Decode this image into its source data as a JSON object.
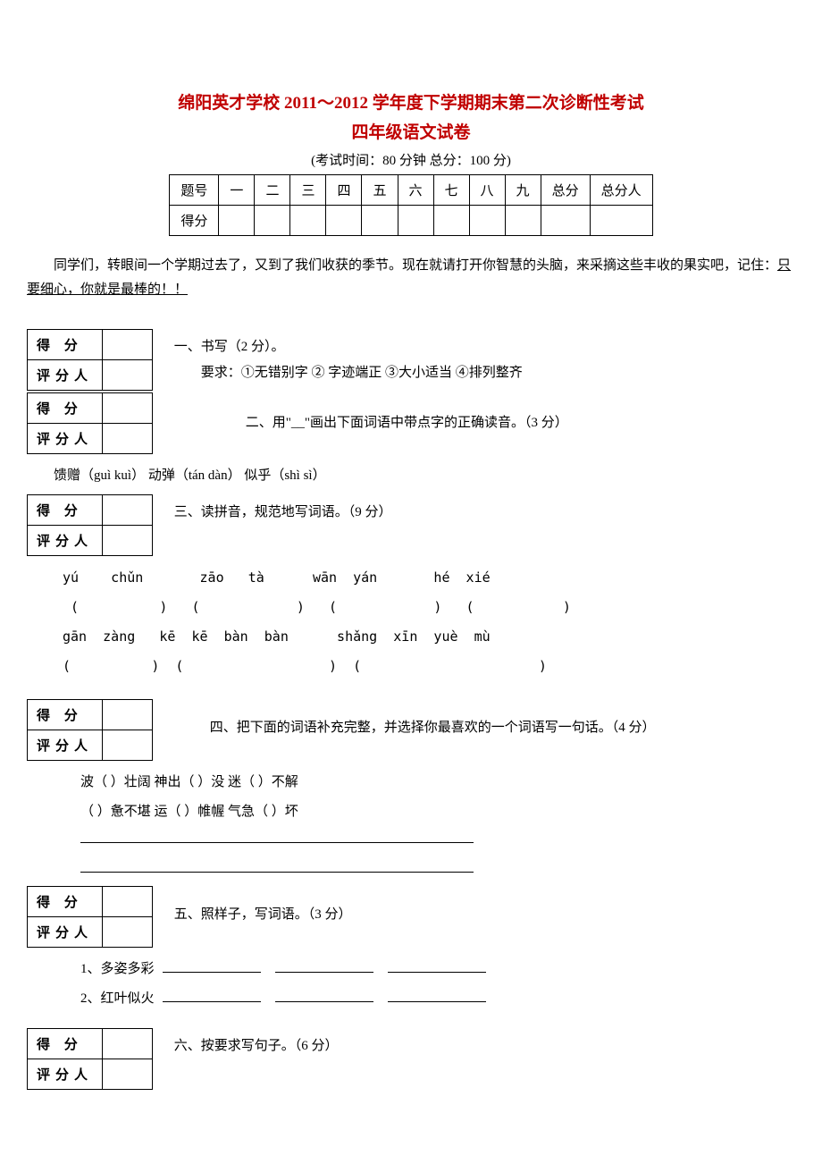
{
  "header": {
    "title1": "绵阳英才学校 2011～2012 学年度下学期期末第二次诊断性考试",
    "title2": "四年级语文试卷",
    "examinfo": "(考试时间：80 分钟   总分：100 分)"
  },
  "scoretable": {
    "row1": [
      "题号",
      "一",
      "二",
      "三",
      "四",
      "五",
      "六",
      "七",
      "八",
      "九",
      "总分",
      "总分人"
    ],
    "row2first": "得分"
  },
  "intro": {
    "part1": "同学们，转眼间一个学期过去了，又到了我们收获的季节。现在就请打开你智慧的头脑，来采摘这些丰收的果实吧，记住：",
    "part2_underline": "只要细心，你就是最棒的！！"
  },
  "gradebox": {
    "l1": "得 分",
    "l2": "评分人"
  },
  "q1": {
    "title": "一、书写（2 分）。",
    "req": "要求：①无错别字 ② 字迹端正 ③大小适当 ④排列整齐"
  },
  "q2": {
    "title": "二、用\"__\"画出下面词语中带点字的正确读音。（3 分）",
    "line1": "馈赠（guì   kuì）    动弹（tán   dàn）    似乎（shì   sì）"
  },
  "q3": {
    "title": "三、读拼音，规范地写词语。（9 分）",
    "line1": "yú    chǔn       zāo   tà      wān  yán       hé  xié",
    "line2": " (          )   (            )   (            )   (           )",
    "line3": "gān  zàng   kē  kē  bàn  bàn      shǎng  xīn  yuè  mù",
    "line4": "(          )  (                  )  (                      )"
  },
  "q4": {
    "title": "四、把下面的词语补充完整，并选择你最喜欢的一个词语写一句话。（4 分）",
    "line1": "波（    ）壮阔       神出（    ）没       迷（    ）不解",
    "line2": "（    ）惫不堪       运（    ）帷幄       气急（    ）坏"
  },
  "q5": {
    "title": "五、照样子，写词语。（3 分）",
    "item1": "1、多姿多彩",
    "item2": "2、红叶似火"
  },
  "q6": {
    "title": "六、按要求写句子。（6 分）"
  }
}
